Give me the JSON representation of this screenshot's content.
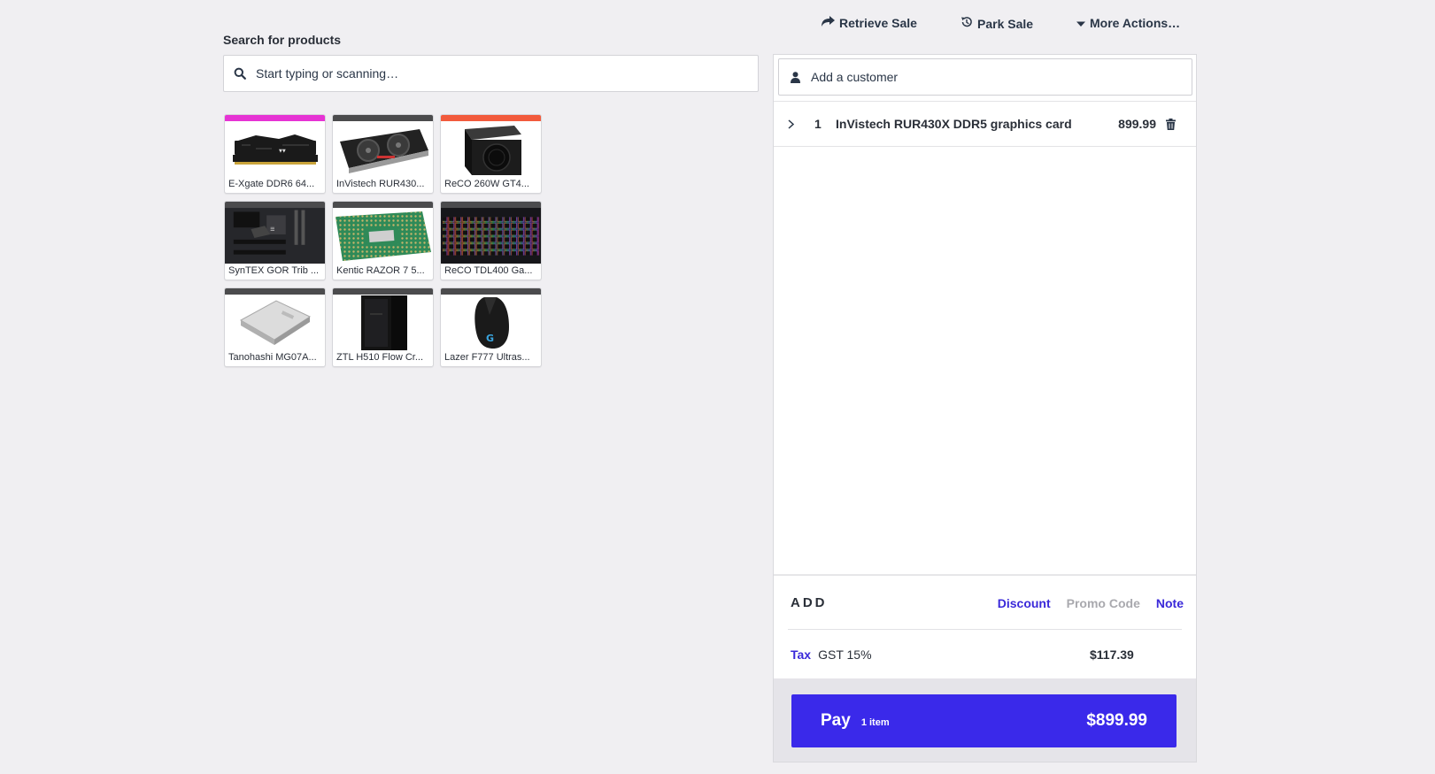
{
  "search": {
    "label": "Search for products",
    "placeholder": "Start typing or scanning…",
    "icon": "search-icon"
  },
  "top_actions": [
    {
      "label": "Retrieve Sale",
      "icon": "share-arrow-icon"
    },
    {
      "label": "Park Sale",
      "icon": "history-clock-icon"
    },
    {
      "label": "More Actions…",
      "icon": "caret-down-icon"
    }
  ],
  "products": [
    {
      "name": "E-Xgate DDR6 64...",
      "bar_color": "#e633d4",
      "thumb": "ram-sticks"
    },
    {
      "name": "InVistech RUR430...",
      "bar_color": "#4b4b4d",
      "thumb": "graphics-card"
    },
    {
      "name": "ReCO 260W GT4...",
      "bar_color": "#f25a3c",
      "thumb": "power-supply"
    },
    {
      "name": "SynTEX GOR Trib ...",
      "bar_color": "#4b4b4d",
      "thumb": "motherboard"
    },
    {
      "name": "Kentic RAZOR 7 5...",
      "bar_color": "#4b4b4d",
      "thumb": "cpu"
    },
    {
      "name": "ReCO TDL400 Ga...",
      "bar_color": "#4b4b4d",
      "thumb": "keyboard"
    },
    {
      "name": "Tanohashi MG07A...",
      "bar_color": "#4b4b4d",
      "thumb": "hard-drive"
    },
    {
      "name": "ZTL H510 Flow Cr...",
      "bar_color": "#4b4b4d",
      "thumb": "pc-case"
    },
    {
      "name": "Lazer F777 Ultras...",
      "bar_color": "#4b4b4d",
      "thumb": "mouse"
    }
  ],
  "customer": {
    "placeholder": "Add a customer",
    "icon": "user-icon"
  },
  "cart": {
    "items": [
      {
        "qty": "1",
        "name": "InVistech RUR430X DDR5 graphics card",
        "price": "899.99"
      }
    ]
  },
  "add_section": {
    "title": "ADD",
    "links": {
      "discount": "Discount",
      "promo": "Promo Code",
      "note": "Note"
    }
  },
  "tax": {
    "label": "Tax",
    "name": "GST 15%",
    "amount": "$117.39"
  },
  "pay": {
    "label": "Pay",
    "count": "1 item",
    "total": "$899.99"
  },
  "colors": {
    "accent": "#3a29ea",
    "link": "#3a29d9",
    "text": "#2a2f38",
    "background": "#f0eff2"
  }
}
